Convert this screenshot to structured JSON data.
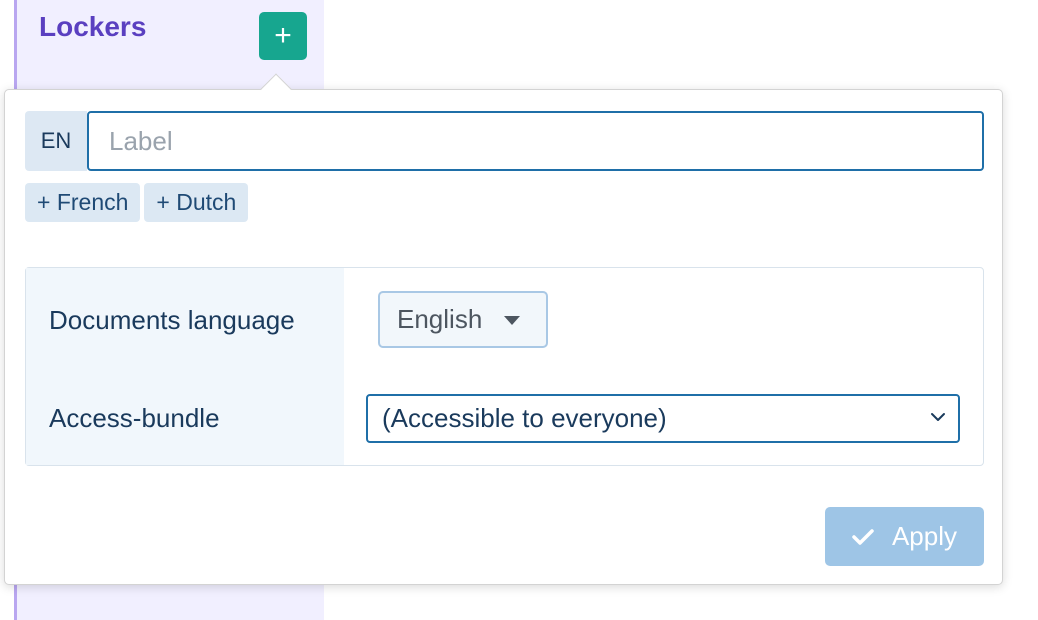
{
  "sidebar": {
    "title": "Lockers",
    "add_button_label": "+"
  },
  "popover": {
    "language_code": "EN",
    "label_placeholder": "Label",
    "label_value": "",
    "add_languages": [
      "+ French",
      "+ Dutch"
    ],
    "settings": {
      "documents_language_label": "Documents language",
      "documents_language_value": "English",
      "access_bundle_label": "Access-bundle",
      "access_bundle_value": "(Accessible to everyone)"
    },
    "apply_label": "Apply"
  },
  "colors": {
    "accent_teal": "#17a68f",
    "sidebar_title": "#5a3fc0",
    "input_border": "#1f6fa8",
    "apply_disabled": "#9ec5e6"
  },
  "icons": {
    "add": "plus-icon",
    "dropdown": "caret-down-icon",
    "select": "chevron-down-icon",
    "apply": "check-icon"
  }
}
